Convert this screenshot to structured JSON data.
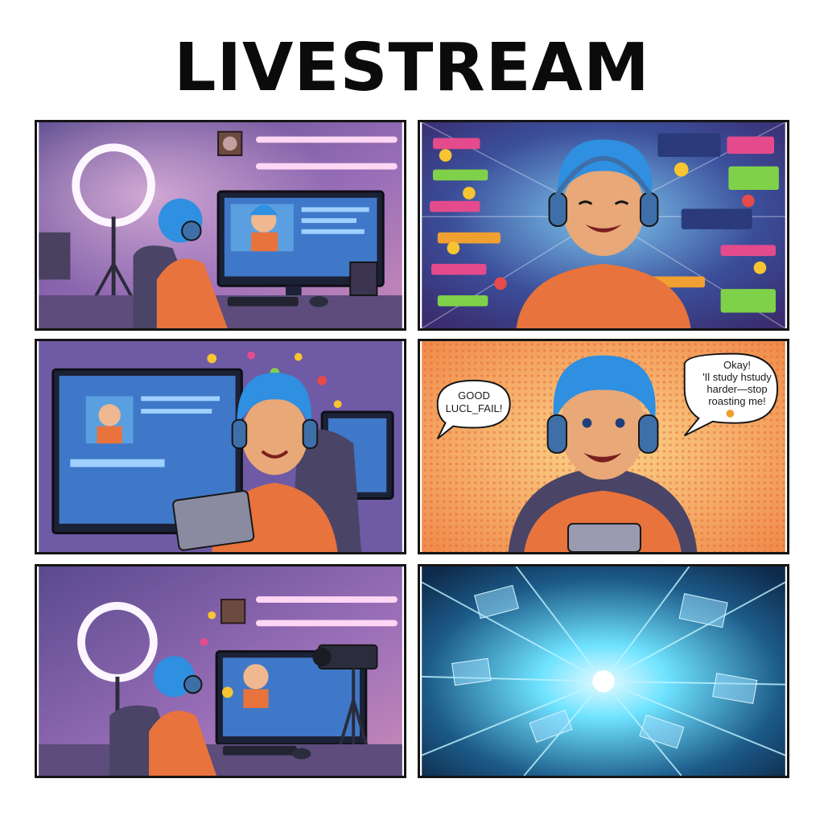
{
  "title": "LIVESTREAM",
  "panels": [
    {
      "id": "setup"
    },
    {
      "id": "chat-flood"
    },
    {
      "id": "homework"
    },
    {
      "id": "reaction",
      "bubble_left": "GOOD\nLUCL_FAIL!",
      "bubble_right": "Okay!\n'Il study hstudy\nharder—stop\nroasting me!"
    },
    {
      "id": "streaming"
    },
    {
      "id": "data-burst"
    }
  ],
  "colors": {
    "room_purple": "#7a5aa8",
    "hair_blue": "#2f8fe0",
    "shirt_orange": "#e8733c",
    "neon_pink": "#ff7ad9",
    "burst_cyan": "#6fe3ff"
  }
}
